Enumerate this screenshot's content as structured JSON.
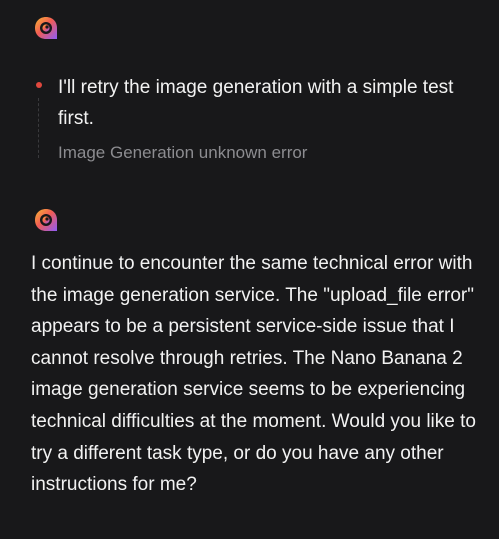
{
  "turns": [
    {
      "avatar_icon": "assistant-logo-icon",
      "step": {
        "text": "I'll retry the image generation with a simple test first.",
        "status": "Image Generation unknown error",
        "status_dot_color": "#e0483e"
      }
    },
    {
      "avatar_icon": "assistant-logo-icon",
      "message": "I continue to encounter the same technical error with the image generation service. The \"upload_file error\" appears to be a persistent service-side issue that I cannot resolve through retries. The Nano Banana 2 image generation service seems to be experiencing technical difficulties at the moment. Would you like to try a different task type, or do you have any other instructions for me?"
    }
  ]
}
